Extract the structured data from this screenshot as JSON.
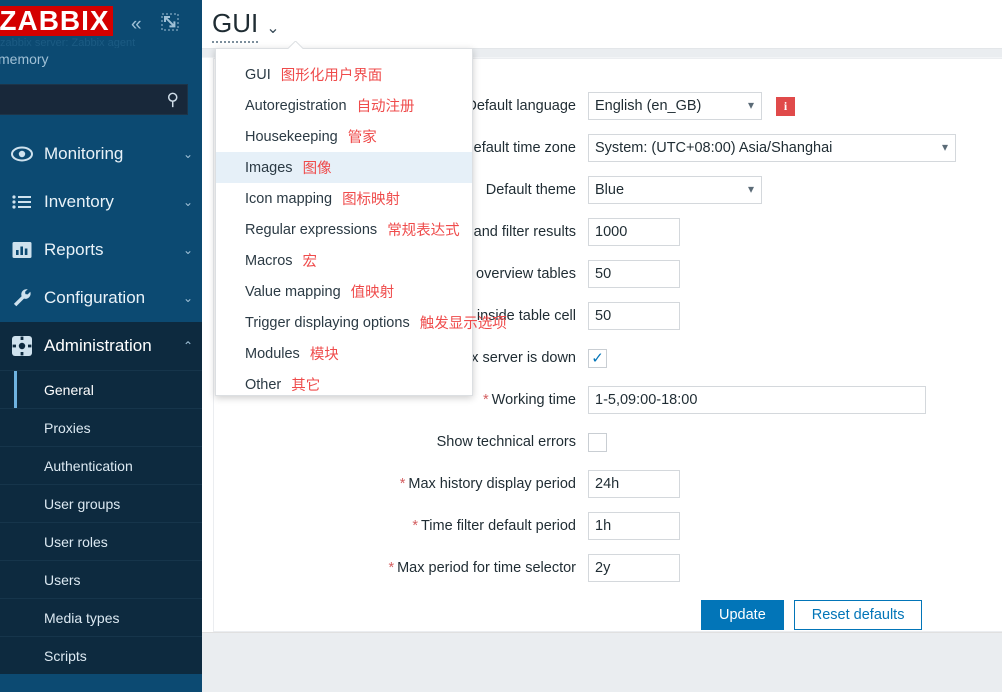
{
  "sidebar": {
    "logo": "ZABBIX",
    "collapse_icon": "chevrons-left-icon",
    "compact_icon": "compact-view-icon",
    "server_faint": "zabbix server: Zabbix agent",
    "server_label": "memory",
    "search": {
      "value": "",
      "placeholder": ""
    },
    "nav": [
      {
        "label": "Monitoring",
        "icon": "eye-icon",
        "chevron": "⌄",
        "active": false
      },
      {
        "label": "Inventory",
        "icon": "list-icon",
        "chevron": "⌄",
        "active": false
      },
      {
        "label": "Reports",
        "icon": "chart-icon",
        "chevron": "⌄",
        "active": false
      },
      {
        "label": "Configuration",
        "icon": "wrench-icon",
        "chevron": "⌄",
        "active": false
      },
      {
        "label": "Administration",
        "icon": "gear-icon",
        "chevron": "⌃",
        "active": true
      }
    ],
    "subnav": [
      {
        "label": "General",
        "selected": true
      },
      {
        "label": "Proxies",
        "selected": false
      },
      {
        "label": "Authentication",
        "selected": false
      },
      {
        "label": "User groups",
        "selected": false
      },
      {
        "label": "User roles",
        "selected": false
      },
      {
        "label": "Users",
        "selected": false
      },
      {
        "label": "Media types",
        "selected": false
      },
      {
        "label": "Scripts",
        "selected": false
      }
    ]
  },
  "header": {
    "title": "GUI",
    "chevron": "⌄"
  },
  "menu": {
    "items": [
      {
        "en": "GUI",
        "zh": "图形化用户界面",
        "highlight": false
      },
      {
        "en": "Autoregistration",
        "zh": "自动注册",
        "highlight": false
      },
      {
        "en": "Housekeeping",
        "zh": "管家",
        "highlight": false
      },
      {
        "en": "Images",
        "zh": "图像",
        "highlight": true
      },
      {
        "en": "Icon mapping",
        "zh": "图标映射",
        "highlight": false
      },
      {
        "en": "Regular expressions",
        "zh": "常规表达式",
        "highlight": false
      },
      {
        "en": "Macros",
        "zh": "宏",
        "highlight": false
      },
      {
        "en": "Value mapping",
        "zh": "值映射",
        "highlight": false
      },
      {
        "en": "Trigger displaying options",
        "zh": "触发显示选项",
        "highlight": false
      },
      {
        "en": "Modules",
        "zh": "模块",
        "highlight": false
      },
      {
        "en": "Other",
        "zh": "其它",
        "highlight": false
      }
    ]
  },
  "form": {
    "rows": [
      {
        "label": "Default language",
        "required": false,
        "kind": "select",
        "value": "English (en_GB)"
      },
      {
        "label": "Default time zone",
        "required": false,
        "kind": "select",
        "value": "System: (UTC+08:00) Asia/Shanghai"
      },
      {
        "label": "Default theme",
        "required": false,
        "kind": "select",
        "value": "Blue"
      },
      {
        "label": "Limit for search and filter results",
        "required": false,
        "kind": "text",
        "value": "1000"
      },
      {
        "label": "Max number of columns and rows in overview tables",
        "required": false,
        "kind": "text",
        "value": "50"
      },
      {
        "label": "Max count of elements to show inside table cell",
        "required": false,
        "kind": "text",
        "value": "50"
      },
      {
        "label": "Show warning if Zabbix server is down",
        "required": false,
        "kind": "checkbox",
        "value": "checked"
      },
      {
        "label": "Working time",
        "required": true,
        "kind": "text",
        "value": "1-5,09:00-18:00"
      },
      {
        "label": "Show technical errors",
        "required": false,
        "kind": "checkbox",
        "value": "unchecked"
      },
      {
        "label": "Max history display period",
        "required": true,
        "kind": "text",
        "value": "24h"
      },
      {
        "label": "Time filter default period",
        "required": true,
        "kind": "text",
        "value": "1h"
      },
      {
        "label": "Max period for time selector",
        "required": true,
        "kind": "text",
        "value": "2y"
      }
    ],
    "info_badge": "i",
    "update_label": "Update",
    "reset_label": "Reset defaults"
  },
  "colors": {
    "sidebar": "#0c4a72",
    "sidebar_active": "#0d2a3f",
    "brand_red": "#d40000",
    "accent_blue": "#0275b8",
    "annotation_red": "#ef4b4b",
    "menu_highlight": "#e6f0f8",
    "page_bg": "#eaedf0"
  }
}
